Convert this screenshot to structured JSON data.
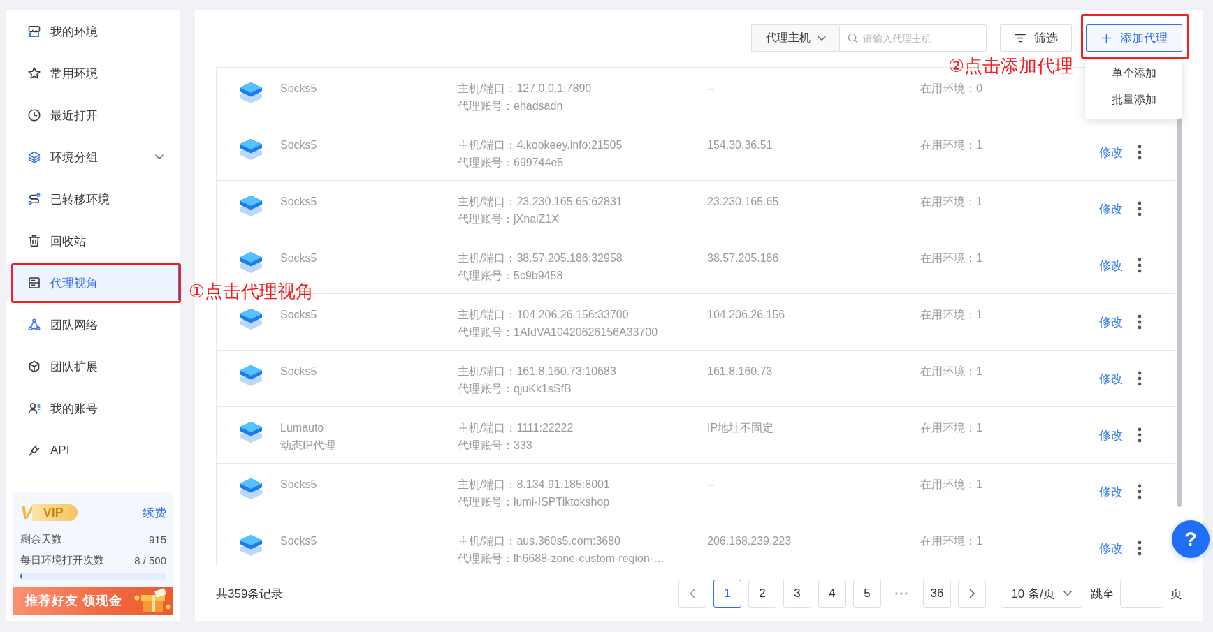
{
  "sidebar": {
    "items": [
      {
        "label": "我的环境",
        "kind": "link",
        "selected": false
      },
      {
        "label": "常用环境",
        "kind": "link",
        "selected": false
      },
      {
        "label": "最近打开",
        "kind": "link",
        "selected": false
      },
      {
        "label": "环境分组",
        "kind": "group",
        "selected": false
      },
      {
        "label": "已转移环境",
        "kind": "link",
        "selected": false
      },
      {
        "label": "回收站",
        "kind": "link",
        "selected": false
      },
      {
        "label": "代理视角",
        "kind": "link",
        "selected": true
      },
      {
        "label": "团队网络",
        "kind": "link",
        "selected": false
      },
      {
        "label": "团队扩展",
        "kind": "link",
        "selected": false
      },
      {
        "label": "我的账号",
        "kind": "link",
        "selected": false
      },
      {
        "label": "API",
        "kind": "link",
        "selected": false
      }
    ]
  },
  "vip": {
    "emblem": "V",
    "badge": "VIP",
    "renew": "续费",
    "stats": [
      {
        "label": "剩余天数",
        "value": "915"
      },
      {
        "label": "每日环境打开次数",
        "value": "8 / 500"
      }
    ],
    "usage": {
      "level": 0.016
    }
  },
  "banner": {
    "text": "推荐好友 领现金"
  },
  "toolbar": {
    "search_field_select": "代理主机",
    "search": {
      "placeholder": "请输入代理主机"
    },
    "filter_button": "筛选",
    "add_button": "添加代理"
  },
  "add_menu": {
    "items": [
      "单个添加",
      "批量添加"
    ]
  },
  "proxies": [
    {
      "name": "Socks5",
      "host": "主机/端口：127.0.0.1:7890",
      "account": "代理账号：ehadsadn",
      "ip": "--",
      "usage": "在用环境：0",
      "more": false
    },
    {
      "name": "Socks5",
      "host": "主机/端口：4.kookeey.info:21505",
      "account": "代理账号：699744e5",
      "ip": "154.30.36.51",
      "usage": "在用环境：1",
      "edit": "修改",
      "more": true
    },
    {
      "name": "Socks5",
      "host": "主机/端口：23.230.165.65:62831",
      "account": "代理账号：jXnaiZ1X",
      "ip": "23.230.165.65",
      "usage": "在用环境：1",
      "edit": "修改",
      "more": true
    },
    {
      "name": "Socks5",
      "host": "主机/端口：38.57.205.186:32958",
      "account": "代理账号：5c9b9458",
      "ip": "38.57.205.186",
      "usage": "在用环境：1",
      "edit": "修改",
      "more": true
    },
    {
      "name": "Socks5",
      "host": "主机/端口：104.206.26.156:33700",
      "account": "代理账号：1AfdVA10420626156A33700",
      "ip": "104.206.26.156",
      "usage": "在用环境：1",
      "edit": "修改",
      "more": true
    },
    {
      "name": "Socks5",
      "host": "主机/端口：161.8.160.73:10683",
      "account": "代理账号：qjuKk1sSfB",
      "ip": "161.8.160.73",
      "usage": "在用环境：1",
      "edit": "修改",
      "more": true
    },
    {
      "name": "Lumauto",
      "subtitle": "动态IP代理",
      "host": "主机/端口：1111:22222",
      "account": "代理账号：333",
      "ip": "IP地址不固定",
      "usage": "在用环境：1",
      "edit": "修改",
      "more": true
    },
    {
      "name": "Socks5",
      "host": "主机/端口：8.134.91.185:8001",
      "account": "代理账号：lumi-ISPTiktokshop",
      "ip": "--",
      "usage": "在用环境：1",
      "edit": "修改",
      "more": true
    },
    {
      "name": "Socks5",
      "host": "主机/端口：aus.360s5.com:3680",
      "account": "代理账号：lh6688-zone-custom-region-…",
      "ip": "206.168.239.223",
      "usage": "在用环境：1",
      "edit": "修改",
      "more": true
    }
  ],
  "pagination": {
    "total": "共359条记录",
    "pages": [
      {
        "kind": "page",
        "label": "1",
        "selected": true
      },
      {
        "kind": "page",
        "label": "2",
        "selected": false
      },
      {
        "kind": "page",
        "label": "3",
        "selected": false
      },
      {
        "kind": "page",
        "label": "4",
        "selected": false
      },
      {
        "kind": "page",
        "label": "5",
        "selected": false
      },
      {
        "kind": "ellipsis",
        "selected": false
      },
      {
        "kind": "page",
        "label": "36",
        "selected": false
      }
    ],
    "page_size": "10 条/页",
    "jump_label": "跳至",
    "jump_suffix": "页"
  },
  "help_button": {
    "label": "?"
  },
  "annotations": [
    {
      "text": "①点击代理视角"
    },
    {
      "text": "②点击添加代理"
    }
  ]
}
